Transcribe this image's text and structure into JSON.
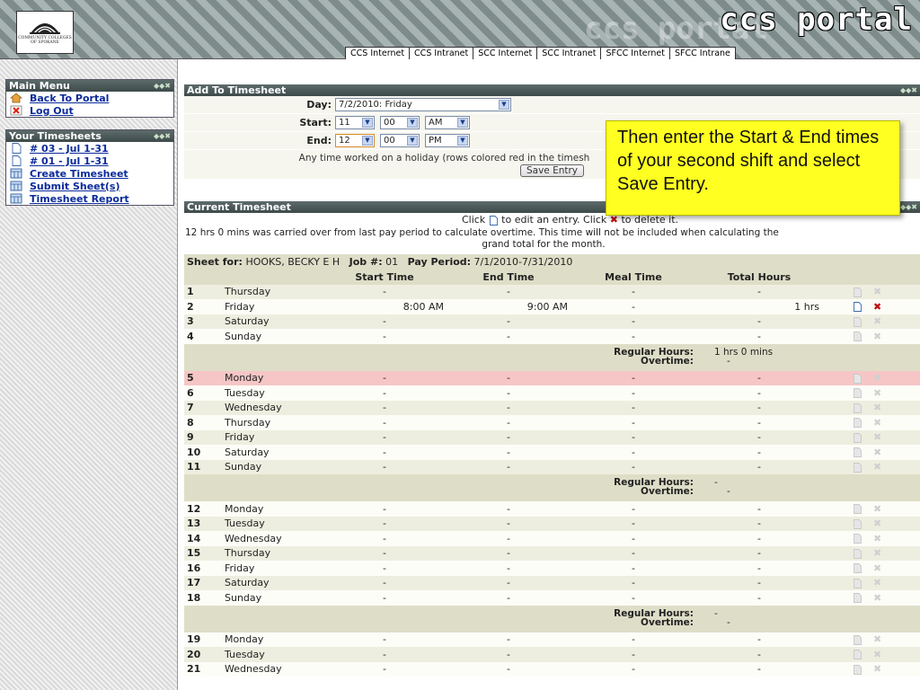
{
  "header": {
    "logo_text": "COMMUNITY COLLEGES OF SPOKANE",
    "title": "ccs portal",
    "tabs": [
      "CCS Internet",
      "CCS Intranet",
      "SCC Internet",
      "SCC Intranet",
      "SFCC Internet",
      "SFCC Intrane"
    ]
  },
  "sidebar": {
    "main_menu": {
      "title": "Main Menu",
      "items": [
        {
          "label": "Back To Portal",
          "icon": "home-icon"
        },
        {
          "label": "Log Out",
          "icon": "close-icon"
        }
      ]
    },
    "timesheets": {
      "title": "Your Timesheets",
      "items": [
        {
          "label": "# 03 - Jul 1-31",
          "icon": "document-icon"
        },
        {
          "label": "# 01 - Jul 1-31",
          "icon": "document-icon"
        },
        {
          "label": "Create Timesheet",
          "icon": "calendar-icon"
        },
        {
          "label": "Submit Sheet(s)",
          "icon": "calendar-icon"
        },
        {
          "label": "Timesheet Report",
          "icon": "calendar-icon"
        }
      ]
    }
  },
  "add_form": {
    "title": "Add To Timesheet",
    "day_label": "Day:",
    "day_value": "7/2/2010: Friday",
    "start_label": "Start:",
    "start": {
      "hour": "11",
      "minute": "00",
      "ampm": "AM"
    },
    "end_label": "End:",
    "end": {
      "hour": "12",
      "minute": "00",
      "ampm": "PM"
    },
    "holiday_note": "Any time worked on a holiday (rows colored red in the timesh",
    "save_label": "Save Entry"
  },
  "callout": {
    "text": "Then enter the Start & End times of your second shift and select Save Entry."
  },
  "current": {
    "title": "Current Timesheet",
    "instructions_pre": "Click",
    "instructions_mid": "to edit an entry. Click",
    "instructions_post": "to delete it.",
    "carryover_line1": "12 hrs 0 mins was carried over from last pay period to calculate overtime. This time will not be included when calculating the",
    "carryover_line2": "grand total for the month.",
    "sheet_for_label": "Sheet for:",
    "sheet_for": "HOOKS, BECKY E H",
    "job_label": "Job #:",
    "job": "01",
    "period_label": "Pay Period:",
    "period": "7/1/2010-7/31/2010",
    "columns": [
      "Start Time",
      "End Time",
      "Meal Time",
      "Total Hours"
    ],
    "regular_label": "Regular Hours:",
    "overtime_label": "Overtime:"
  }
}
